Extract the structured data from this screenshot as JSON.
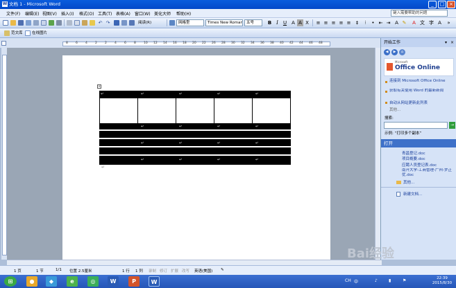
{
  "window": {
    "title": "文档 1 - Microsoft Word"
  },
  "menu": {
    "items": [
      "文件(F)",
      "编辑(E)",
      "视图(V)",
      "插入(I)",
      "格式(O)",
      "工具(T)",
      "表格(A)",
      "窗口(W)",
      "美化大师",
      "帮助(H)"
    ],
    "ask_placeholder": "键入需要帮助的问题"
  },
  "toolbar": {
    "reading": "阅读(R)",
    "style": "网格型",
    "font": "Times New Roman",
    "size": "五号",
    "bold": "B",
    "italic": "I",
    "underline": "U"
  },
  "toolbar2": {
    "template": "范文库",
    "online": "在线图片"
  },
  "ruler": {
    "ticks": [
      "8",
      "6",
      "4",
      "2",
      "2",
      "4",
      "6",
      "8",
      "10",
      "12",
      "14",
      "16",
      "18",
      "20",
      "22",
      "26",
      "28",
      "30",
      "32",
      "34",
      "36",
      "38",
      "40",
      "42",
      "44",
      "46",
      "48"
    ]
  },
  "document": {
    "mark": "↵"
  },
  "taskpane": {
    "title": "开始工作",
    "logo_small": "Microsoft",
    "logo": "Office Online",
    "links": [
      "连接到 Microsoft Office Online",
      "获取有关使用 Word 的最新新闻",
      "自动从网站更新此列表"
    ],
    "more": "其他...",
    "search_label": "搜索:",
    "example": "示例: “打印多个副本”",
    "open_header": "打开",
    "files": [
      "青昌登记.doc",
      "项目概要.doc",
      "应聘人员登记表.doc",
      "南开大学-工商管理-广州-罗正优.doc"
    ],
    "more2": "其他...",
    "new_doc": "新建文档..."
  },
  "status": {
    "page": "1 页",
    "section": "1 节",
    "pages": "1/1",
    "position": "位置 2.5厘米",
    "line": "1 行",
    "col": "1 列",
    "rec": "录制",
    "trk": "修订",
    "ext": "扩展",
    "ovr": "改写",
    "lang": "英语(美国)"
  },
  "taskbar": {
    "time": "22:39",
    "date": "2015/8/30",
    "ime": "中",
    "lang": "CH"
  },
  "watermark": "Bai经验"
}
